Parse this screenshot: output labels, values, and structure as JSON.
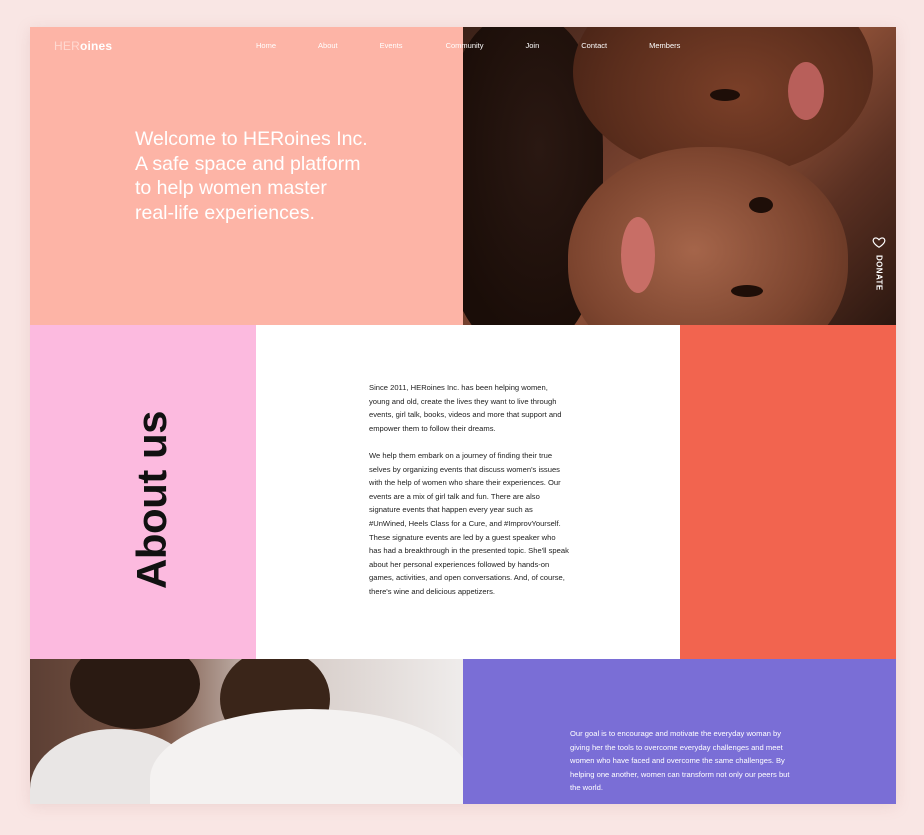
{
  "site": {
    "logo_accent": "HER",
    "logo_rest": "oines",
    "nav": [
      "Home",
      "About",
      "Events",
      "Community",
      "Join",
      "Contact",
      "Members"
    ],
    "hero_lines": [
      "Welcome to HERoines Inc.",
      "A safe space and platform",
      "to help women master",
      "real-life experiences."
    ],
    "donate_label": "DONATE",
    "about_title": "About us",
    "about_paragraphs": [
      "Since 2011, HERoines Inc. has been helping women, young and old, create the lives they want to live through events, girl talk, books, videos and more that support and empower them to follow their dreams.",
      "We help them embark on a journey of finding their true selves by organizing events that discuss women's issues with the help of women who share their experiences. Our events are a mix of girl talk and fun. There are also signature events that happen every year such as #UnWined, Heels Class for a Cure, and #ImprovYourself. These signature events are led by a guest speaker who has had a breakthrough in the presented topic. She'll speak about her personal experiences followed by hands-on games, activities, and open conversations. And, of course, there's wine and delicious appetizers."
    ],
    "goal_text": "Our goal is to encourage and motivate the everyday woman by giving her the tools to overcome everyday challenges and meet women who have faced and overcome the same challenges. By helping one another, women can transform not only our peers but the world."
  },
  "colors": {
    "hero_bg": "#fdb4a6",
    "about_left_bg": "#fcbadf",
    "about_right_bg": "#f2644f",
    "goal_bg": "#7a6ed6",
    "page_bg": "#f9e6e4"
  },
  "icons": {
    "donate": "heart-icon"
  }
}
